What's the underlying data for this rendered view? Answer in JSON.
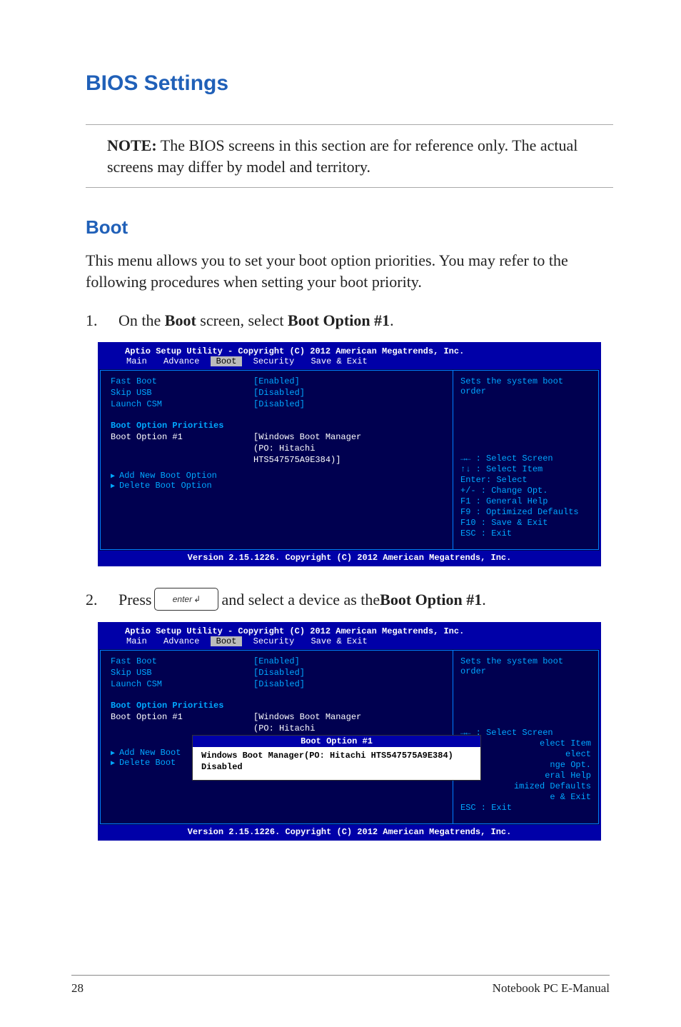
{
  "h1": "BIOS Settings",
  "note": {
    "label": "NOTE:",
    "text": " The BIOS screens in this section are for reference only. The actual screens may differ by model and territory."
  },
  "h2": "Boot",
  "intro": "This menu allows you to set your boot option priorities. You may refer to the following procedures when setting your boot priority.",
  "steps": {
    "s1": {
      "num": "1.",
      "pre": "On the ",
      "b1": "Boot",
      "mid": " screen, select ",
      "b2": "Boot Option #1",
      "post": "."
    },
    "s2": {
      "num": "2.",
      "pre": "Press ",
      "key": "enter",
      "mid": " and select a device as the ",
      "b1": "Boot Option #1",
      "post": "."
    }
  },
  "bios": {
    "top": "Aptio Setup Utility - Copyright (C) 2012 American Megatrends, Inc.",
    "tabs": [
      "Main",
      "Advance",
      "Boot",
      "Security",
      "Save & Exit"
    ],
    "rows": {
      "fast_boot": {
        "k": "Fast Boot",
        "v": "[Enabled]"
      },
      "skip_usb": {
        "k": "Skip USB",
        "v": "[Disabled]"
      },
      "launch_csm": {
        "k": "Launch CSM",
        "v": "[Disabled]"
      },
      "prio_header": "Boot Option Priorities",
      "boot1": {
        "k": "Boot Option #1",
        "v1": "[Windows Boot Manager",
        "v2": "(PO: Hitachi",
        "v3": "HTS547575A9E384)]"
      },
      "add_new": "Add New Boot Option",
      "delete": "Delete Boot Option",
      "add_new_short": "Add New Boot",
      "delete_short": "Delete Boot"
    },
    "help": {
      "desc": "Sets the system boot order",
      "lines": [
        "→←  : Select Screen",
        "↑↓  : Select Item",
        "Enter: Select",
        "+/-  : Change Opt.",
        "F1   : General Help",
        "F9   : Optimized Defaults",
        "F10  : Save & Exit",
        "ESC  : Exit"
      ],
      "lines_cut": [
        "→←  : Select Screen",
        "elect Item",
        "elect",
        "nge Opt.",
        "eral Help",
        "imized Defaults",
        "e & Exit",
        "ESC  : Exit"
      ]
    },
    "bottom": "Version 2.15.1226. Copyright (C) 2012 American Megatrends, Inc."
  },
  "popup": {
    "title": "Boot Option #1",
    "items": [
      "Windows Boot Manager(PO: Hitachi HTS547575A9E384)",
      "Disabled"
    ]
  },
  "footer": {
    "page": "28",
    "title": "Notebook PC E-Manual"
  }
}
